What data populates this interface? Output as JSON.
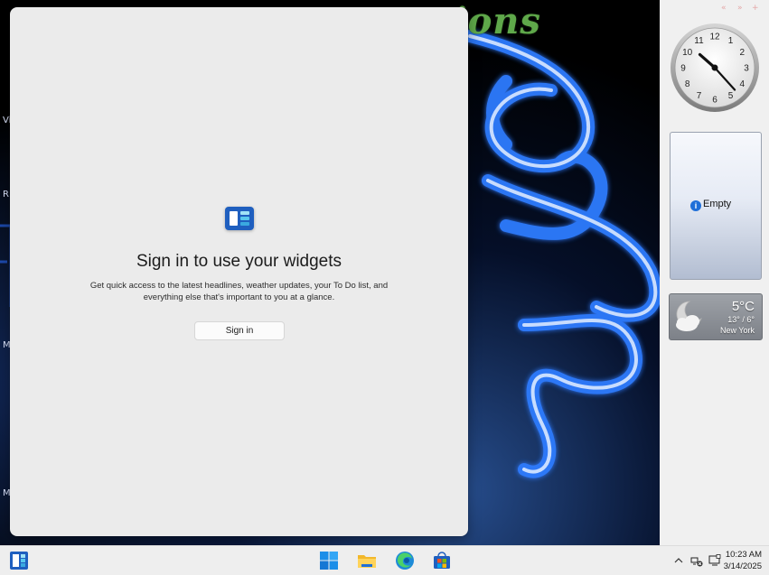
{
  "desktop": {
    "wallpaper_title": "ations",
    "side_letters": [
      "Vi",
      "R",
      "M",
      "M"
    ]
  },
  "widgets_panel": {
    "heading": "Sign in to use your widgets",
    "description": "Get quick access to the latest headlines, weather updates, your To Do list, and everything else that's important to you at a glance.",
    "signin_label": "Sign in"
  },
  "gadgets": {
    "clock": {
      "numbers": [
        "12",
        "1",
        "2",
        "3",
        "4",
        "5",
        "6",
        "7",
        "8",
        "9",
        "10",
        "11"
      ],
      "hour": 10,
      "minute": 23
    },
    "slideshow": {
      "empty_label": "Empty"
    },
    "weather": {
      "temperature": "5°C",
      "range": "13° / 6°",
      "city": "New York",
      "icon": "partly-cloudy-night-icon"
    }
  },
  "taskbar": {
    "items": [
      "widgets-icon",
      "start-icon",
      "file-explorer-icon",
      "edge-icon",
      "store-icon"
    ],
    "tray": [
      "chevron-up-icon",
      "network-disconnected-icon",
      "display-icon"
    ],
    "time": "10:23 AM",
    "date": "3/14/2025"
  },
  "colors": {
    "panel_bg": "#ebebeb",
    "accent": "#1f5fbf",
    "wallpaper_glow": "#3a7cff",
    "wallpaper_title": "#5fa84a"
  }
}
